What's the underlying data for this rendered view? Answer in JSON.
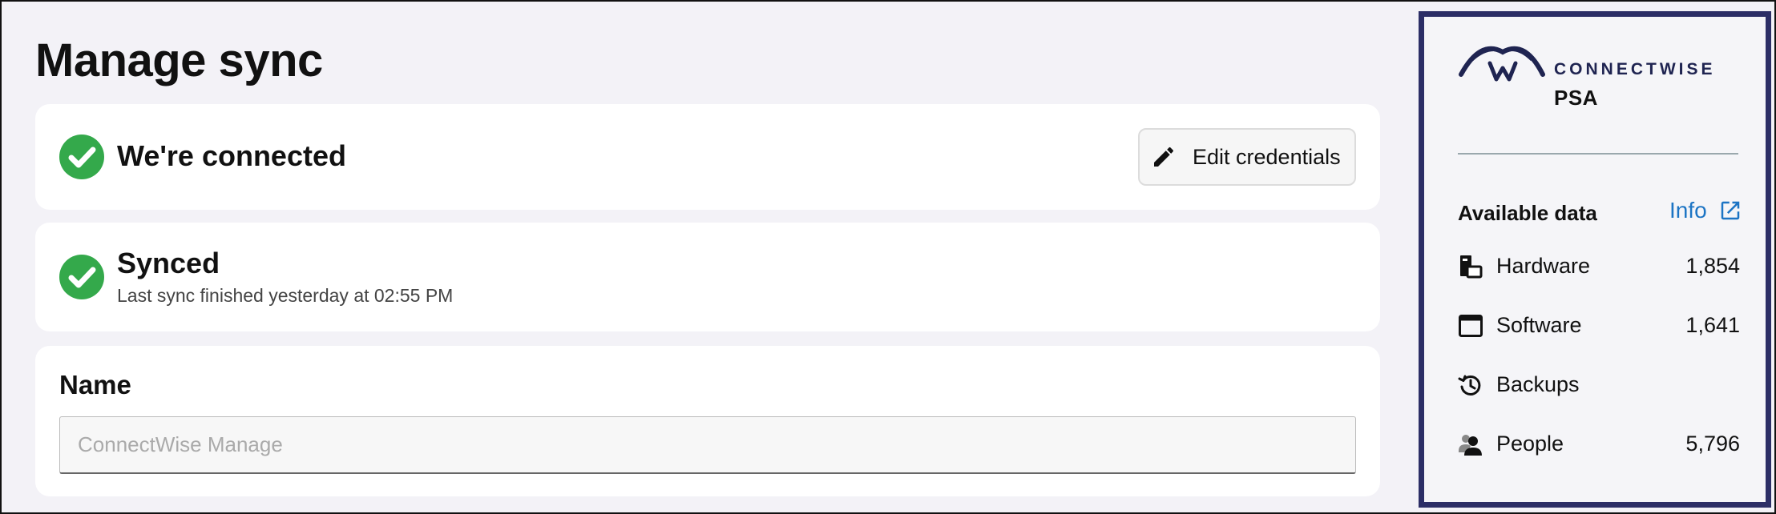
{
  "page": {
    "title": "Manage sync"
  },
  "connection": {
    "status": "We're connected",
    "edit_button_label": "Edit credentials"
  },
  "sync": {
    "status": "Synced",
    "last_sync": "Last sync finished yesterday at 02:55 PM"
  },
  "name_field": {
    "label": "Name",
    "placeholder": "ConnectWise Manage",
    "value": ""
  },
  "integration": {
    "brand": "CONNECTWISE",
    "product": "PSA",
    "available_title": "Available data",
    "info_label": "Info",
    "items": [
      {
        "label": "Hardware",
        "count": "1,854",
        "icon": "hardware-icon"
      },
      {
        "label": "Software",
        "count": "1,641",
        "icon": "software-window-icon"
      },
      {
        "label": "Backups",
        "count": "",
        "icon": "backup-history-icon"
      },
      {
        "label": "People",
        "count": "5,796",
        "icon": "people-icon"
      }
    ]
  },
  "colors": {
    "success": "#34a94b",
    "link": "#1c74c4",
    "panel_border": "#2c2e66",
    "background": "#f3f2f7"
  }
}
